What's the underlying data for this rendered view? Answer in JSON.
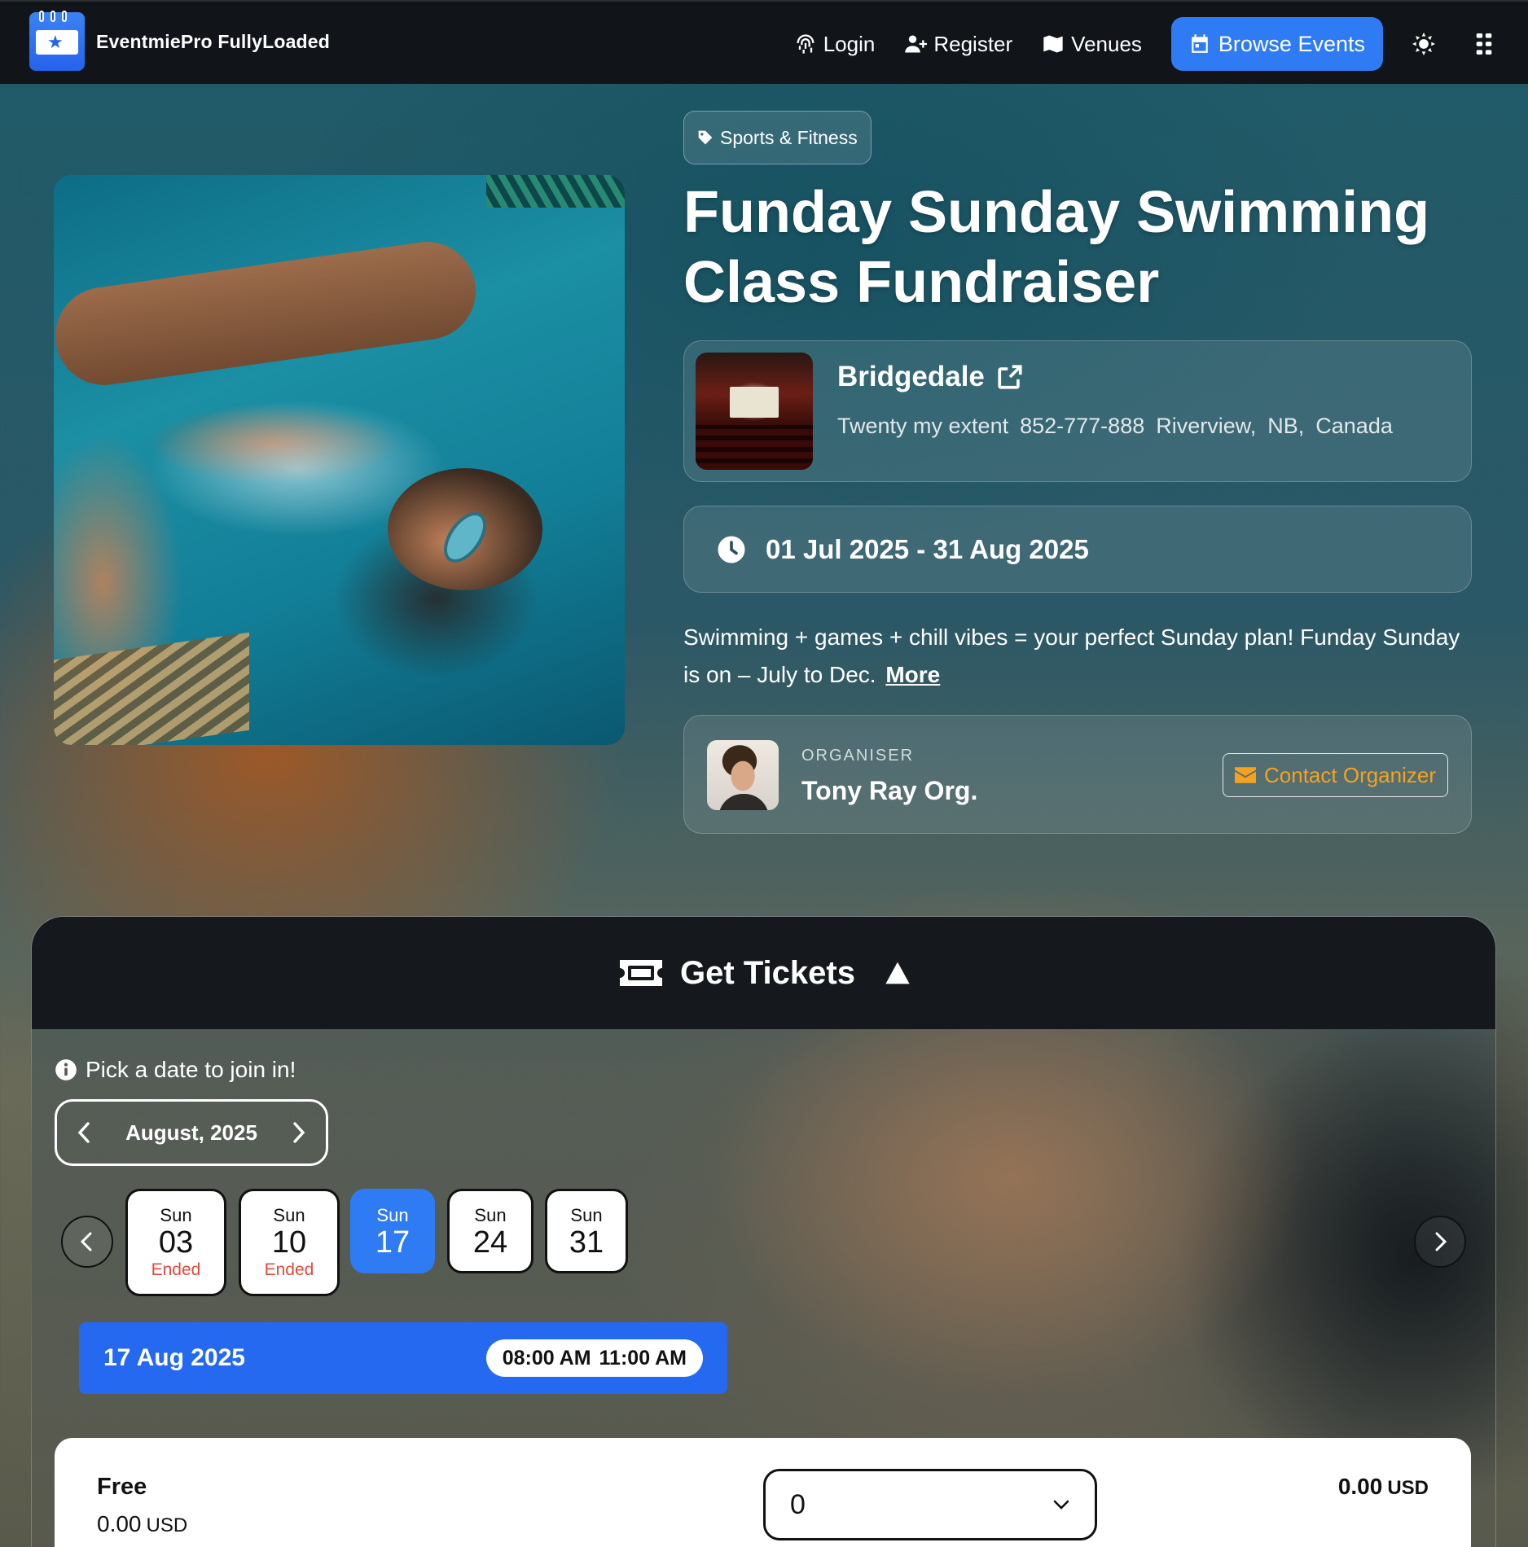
{
  "brand": {
    "name": "EventmiePro FullyLoaded"
  },
  "nav": {
    "login": "Login",
    "register": "Register",
    "venues": "Venues",
    "browse_events": "Browse Events"
  },
  "event": {
    "category": "Sports & Fitness",
    "title": "Funday Sunday Swimming Class Fundraiser",
    "venue": {
      "name": "Bridgedale",
      "address_line": "Twenty my extent",
      "phone": "852-777-888",
      "city": "Riverview,",
      "state": "NB,",
      "country": "Canada"
    },
    "date_range": "01 Jul 2025 - 31 Aug 2025",
    "excerpt": "Swimming + games + chill vibes = your perfect Sunday plan! Funday Sunday is on – July to Dec.",
    "more_link": "More",
    "organiser": {
      "label": "ORGANISER",
      "name": "Tony Ray Org.",
      "contact_label": "Contact Organizer"
    }
  },
  "tickets": {
    "title": "Get Tickets",
    "pick_hint": "Pick a date to join in!",
    "month": "August, 2025",
    "dates": [
      {
        "dow": "Sun",
        "day": "03",
        "status": "Ended"
      },
      {
        "dow": "Sun",
        "day": "10",
        "status": "Ended"
      },
      {
        "dow": "Sun",
        "day": "17",
        "status": ""
      },
      {
        "dow": "Sun",
        "day": "24",
        "status": ""
      },
      {
        "dow": "Sun",
        "day": "31",
        "status": ""
      }
    ],
    "selected_date": "17 Aug 2025",
    "start_time": "08:00 AM",
    "end_time": "11:00 AM",
    "ticket": {
      "name": "Free",
      "price": "0.00",
      "currency": "USD",
      "quantity": "0",
      "total": "0.00",
      "total_currency": "USD"
    }
  },
  "colors": {
    "accent": "#2f7bf3",
    "navbar": "#111418",
    "ended": "#e04a3c",
    "contact": "#f6a21e"
  }
}
